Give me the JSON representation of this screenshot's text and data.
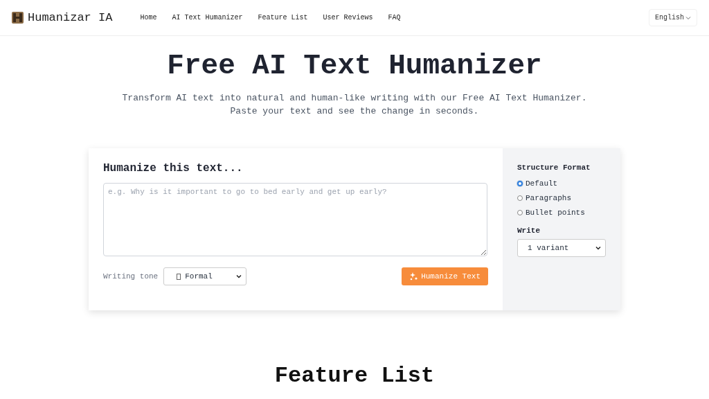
{
  "brand": {
    "name": "Humanizar IA"
  },
  "nav": [
    "Home",
    "AI Text Humanizer",
    "Feature List",
    "User Reviews",
    "FAQ"
  ],
  "language": {
    "label": "English"
  },
  "hero": {
    "title": "Free AI Text Humanizer",
    "subtitle": "Transform AI text into natural and human-like writing with our Free AI Text Humanizer. Paste your text and see the change in seconds."
  },
  "editor": {
    "heading": "Humanize this text...",
    "input": {
      "placeholder": "e.g. Why is it important to go to bed early and get up early?"
    },
    "tone_label": "Writing tone",
    "tone": "Formal",
    "button": "Humanize Text"
  },
  "options": {
    "structure_label": "Structure Format",
    "structure": [
      {
        "label": "Default",
        "selected": true
      },
      {
        "label": "Paragraphs",
        "selected": false
      },
      {
        "label": "Bullet points",
        "selected": false
      }
    ],
    "write_label": "Write",
    "write": "1 variant"
  },
  "next_section": {
    "title": "Feature List"
  }
}
